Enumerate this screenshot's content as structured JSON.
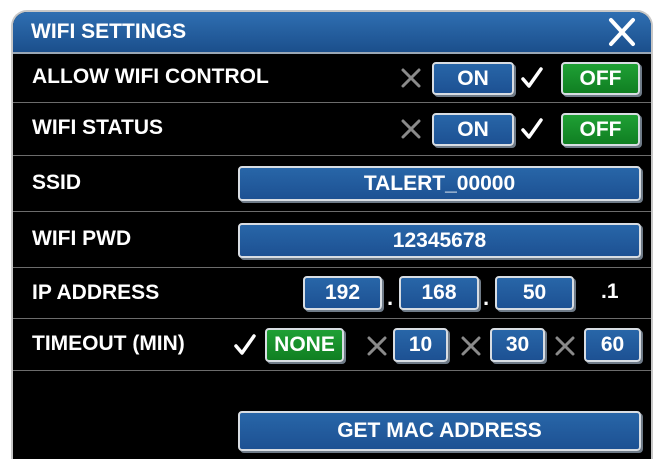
{
  "window": {
    "title": "WIFI SETTINGS"
  },
  "rows": {
    "allow_wifi_control": {
      "label": "ALLOW WIFI CONTROL",
      "on_label": "ON",
      "off_label": "OFF",
      "selected": "OFF"
    },
    "wifi_status": {
      "label": "WIFI STATUS",
      "on_label": "ON",
      "off_label": "OFF",
      "selected": "OFF"
    },
    "ssid": {
      "label": "SSID",
      "value": "TALERT_00000"
    },
    "wifi_pwd": {
      "label": "WIFI PWD",
      "value": "12345678"
    },
    "ip_address": {
      "label": "IP ADDRESS",
      "octets": [
        "192",
        "168",
        "50"
      ],
      "separator": ".",
      "last_octet": ".1"
    },
    "timeout": {
      "label": "TIMEOUT (MIN)",
      "options": [
        "NONE",
        "10",
        "30",
        "60"
      ],
      "selected": "NONE"
    },
    "mac": {
      "button_label": "GET MAC ADDRESS"
    }
  },
  "icons": {
    "close": "close-x-icon",
    "selected": "check-icon",
    "unselected": "x-icon"
  },
  "colors": {
    "title_bar": "#1f5a9c",
    "button_blue": "#2866a8",
    "button_selected": "#1a9a30",
    "background": "#000000"
  }
}
